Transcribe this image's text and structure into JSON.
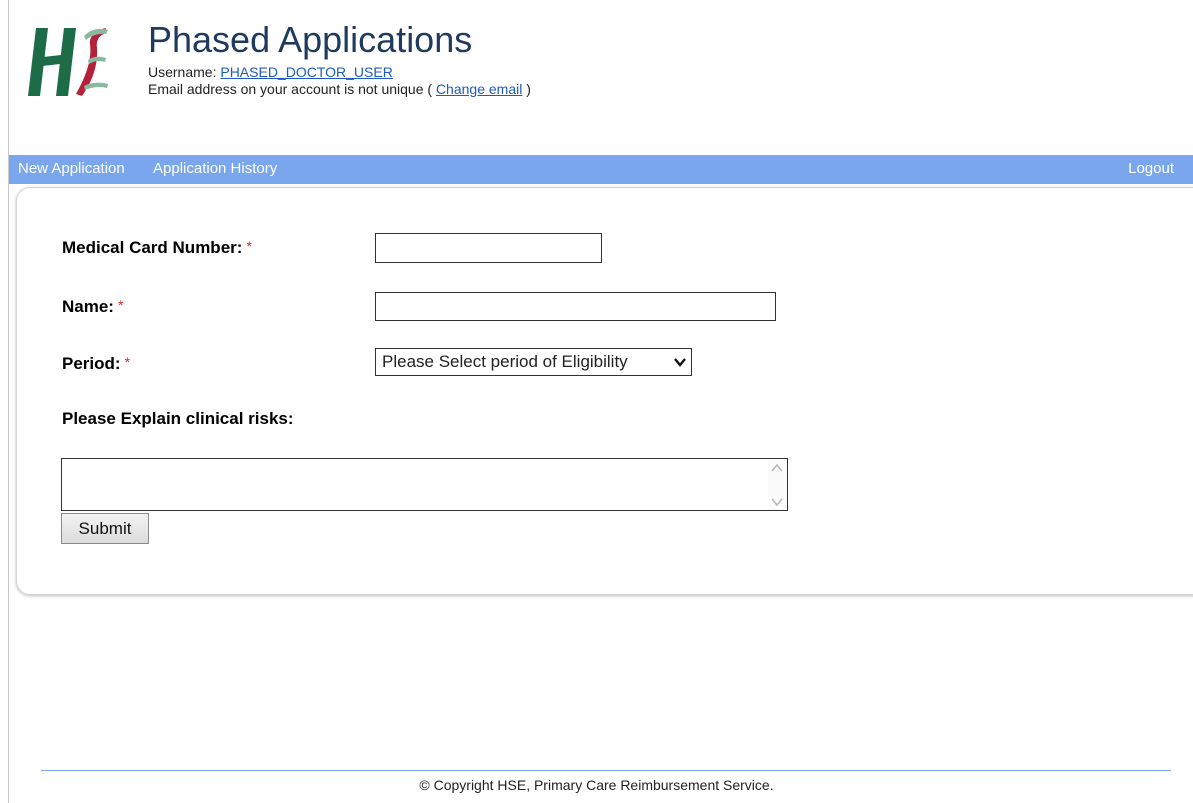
{
  "header": {
    "title": "Phased Applications",
    "username_label": "Username: ",
    "username": "PHASED_DOCTOR_USER",
    "email_notice": "Email address on your account is not unique ( ",
    "change_email": "Change email",
    "email_notice_end": " )"
  },
  "nav": {
    "new_application": "New Application",
    "application_history": "Application History",
    "logout": "Logout"
  },
  "form": {
    "medical_card_label": "Medical Card Number:",
    "medical_card_value": "",
    "name_label": "Name:",
    "name_value": "",
    "period_label": "Period:",
    "period_selected": "Please Select period of Eligibility",
    "clinical_label": "Please Explain clinical risks:",
    "clinical_value": "",
    "required_marker": "*",
    "submit_label": "Submit"
  },
  "footer": {
    "copyright": "© Copyright HSE, Primary Care Reimbursement Service."
  },
  "colors": {
    "nav_bg": "#7aa6ee",
    "logo_green": "#1e6b47",
    "logo_red": "#b3223a",
    "title": "#1f3a5f",
    "link": "#1f5bbf",
    "required": "#dd2222"
  },
  "icons": {
    "logo": "hse-logo",
    "select_arrow": "chevron-down-icon",
    "scroll_up": "chevron-up-icon",
    "scroll_down": "chevron-down-icon"
  }
}
